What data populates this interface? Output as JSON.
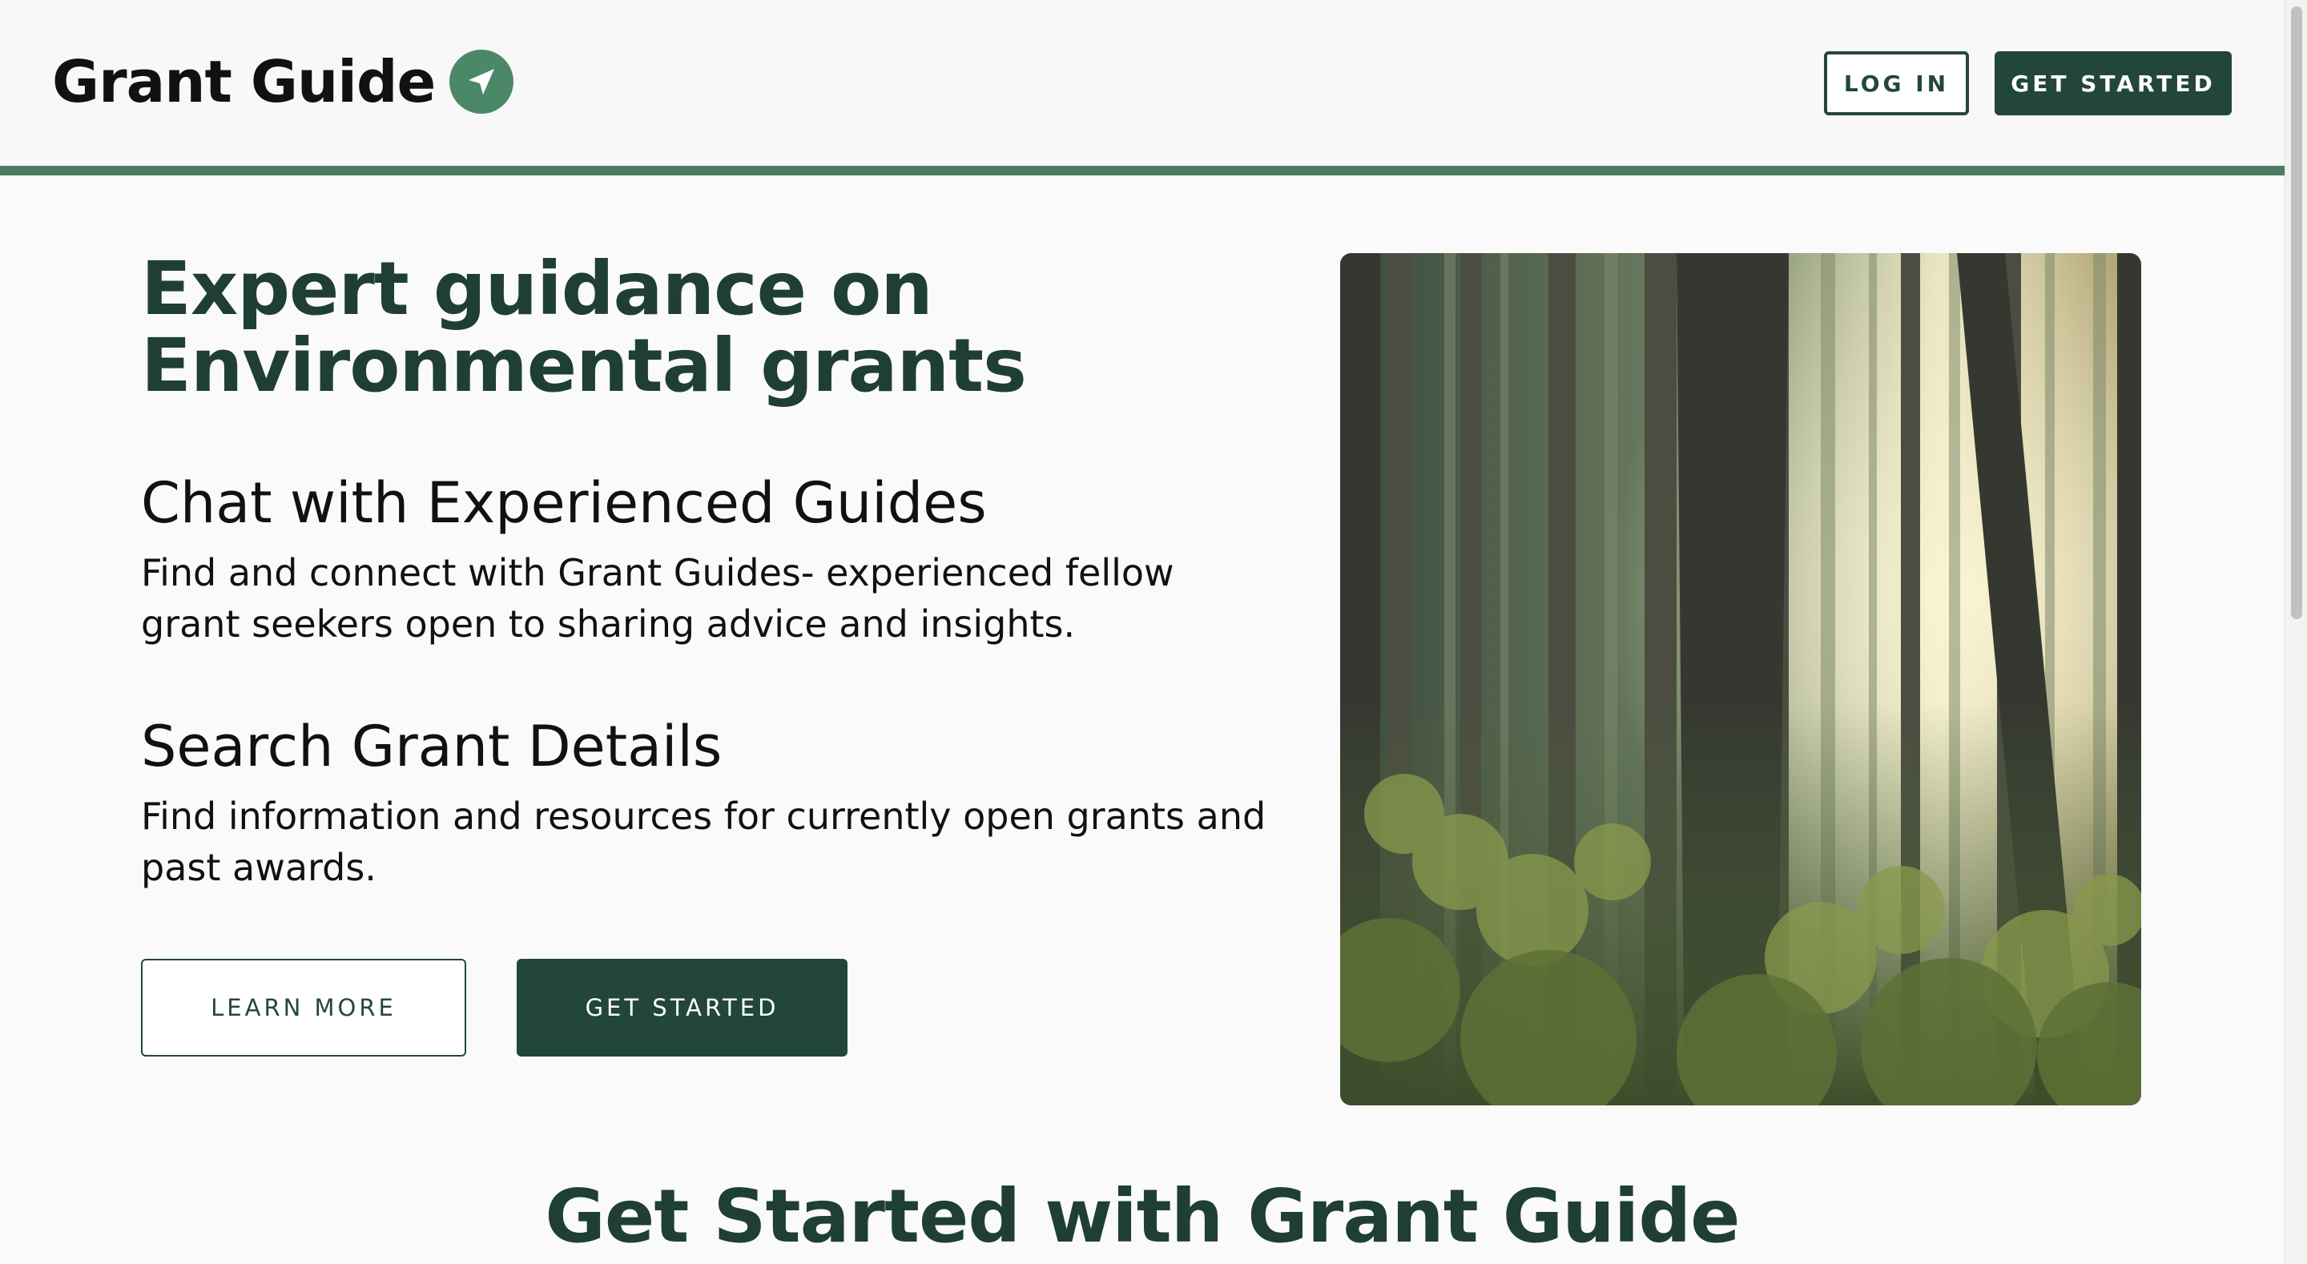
{
  "header": {
    "brand": "Grant Guide",
    "brand_icon": "navigation-arrow-icon",
    "login_label": "LOG IN",
    "get_started_label": "GET STARTED"
  },
  "hero": {
    "title_line1": "Expert guidance on",
    "title_line2": "Environmental grants",
    "features": [
      {
        "title": "Chat with Experienced Guides",
        "desc_line1": "Find and connect with Grant Guides- experienced fellow",
        "desc_line2": "grant seekers open to sharing advice and insights."
      },
      {
        "title": "Search Grant Details",
        "desc_line1": "Find information and resources for currently open grants and",
        "desc_line2": "past awards."
      }
    ],
    "learn_more_label": "LEARN MORE",
    "get_started_label": "GET STARTED",
    "image_subject": "forest photo"
  },
  "section": {
    "title": "Get Started with Grant Guide"
  },
  "colors": {
    "brand_dark": "#22463a",
    "brand_accent": "#4f7b63",
    "logo_badge": "#4a8868",
    "background": "#fafafa"
  }
}
